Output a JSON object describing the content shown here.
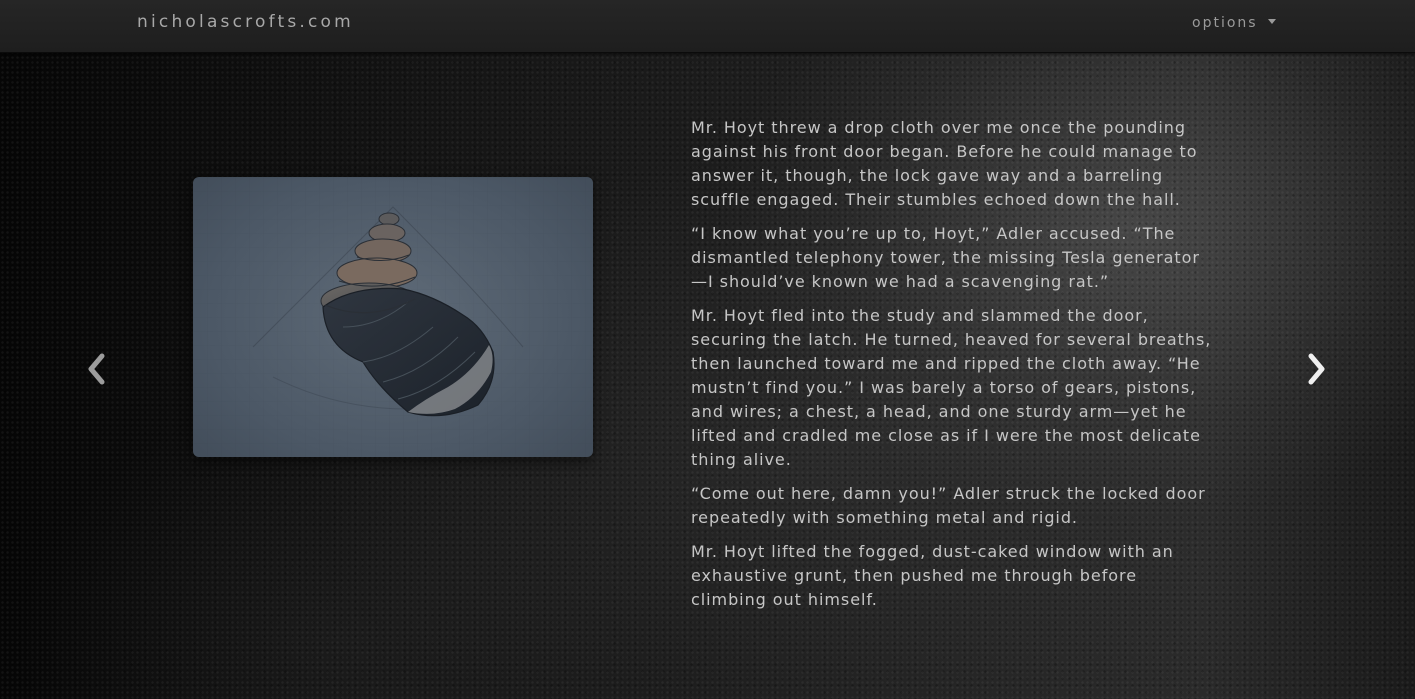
{
  "navbar": {
    "brand": "nicholascrofts.com",
    "options_label": "options"
  },
  "carousel": {
    "prev_icon": "chevron-left-icon",
    "next_icon": "chevron-right-icon"
  },
  "illustration": {
    "subject": "spiral-seashell-sketch"
  },
  "story": {
    "paragraphs": [
      "Mr. Hoyt threw a drop cloth over me once the pounding\nagainst his front door began. Before he could manage to\nanswer it, though, the lock gave way and a barreling\nscuffle engaged. Their stumbles echoed down the hall.",
      "“I know what you’re up to, Hoyt,” Adler accused. “The\ndismantled telephony tower, the missing Tesla generator\n—I should’ve known we had a scavenging rat.”",
      "Mr. Hoyt fled into the study and slammed the door,\nsecuring the latch. He turned, heaved for several breaths,\nthen launched toward me and ripped the cloth away. “He\nmustn’t find you.” I was barely a torso of gears, pistons,\nand wires; a chest, a head, and one sturdy arm—yet he\nlifted and cradled me close as if I were the most delicate\nthing alive.",
      "“Come out here, damn you!” Adler struck the locked door\nrepeatedly with something metal and rigid.",
      "Mr. Hoyt lifted the fogged, dust-caked window with an\nexhaustive grunt, then pushed me through before\nclimbing out himself."
    ]
  },
  "colors": {
    "navbar_bg": "#222222",
    "brand_text": "#a8a8a8",
    "body_text": "#c6c6c6",
    "illustration_bg": "#556170"
  }
}
